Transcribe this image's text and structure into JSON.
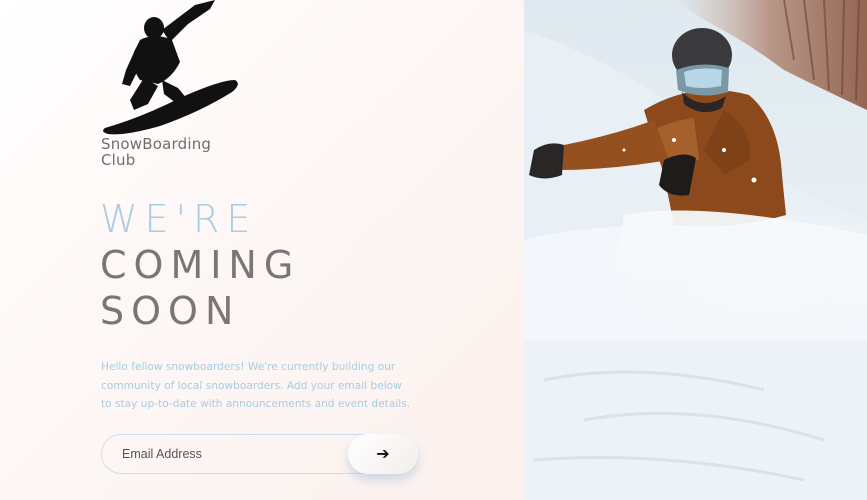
{
  "brand": {
    "name_line1": "SnowBoarding",
    "name_line2": "Club"
  },
  "headline": {
    "line1": "WE'RE",
    "line2": "COMING",
    "line3": "SOON"
  },
  "intro": "Hello fellow snowboarders! We're currently building our community of local snowboarders. Add your email below to stay up-to-date with announcements and event details.",
  "form": {
    "email_placeholder": "Email Address",
    "email_value": "",
    "submit_icon": "arrow-right-icon"
  },
  "colors": {
    "accent_blue": "#a8cce4",
    "heading_gray": "#7a7676",
    "background_tint": "#fbf1ee"
  }
}
